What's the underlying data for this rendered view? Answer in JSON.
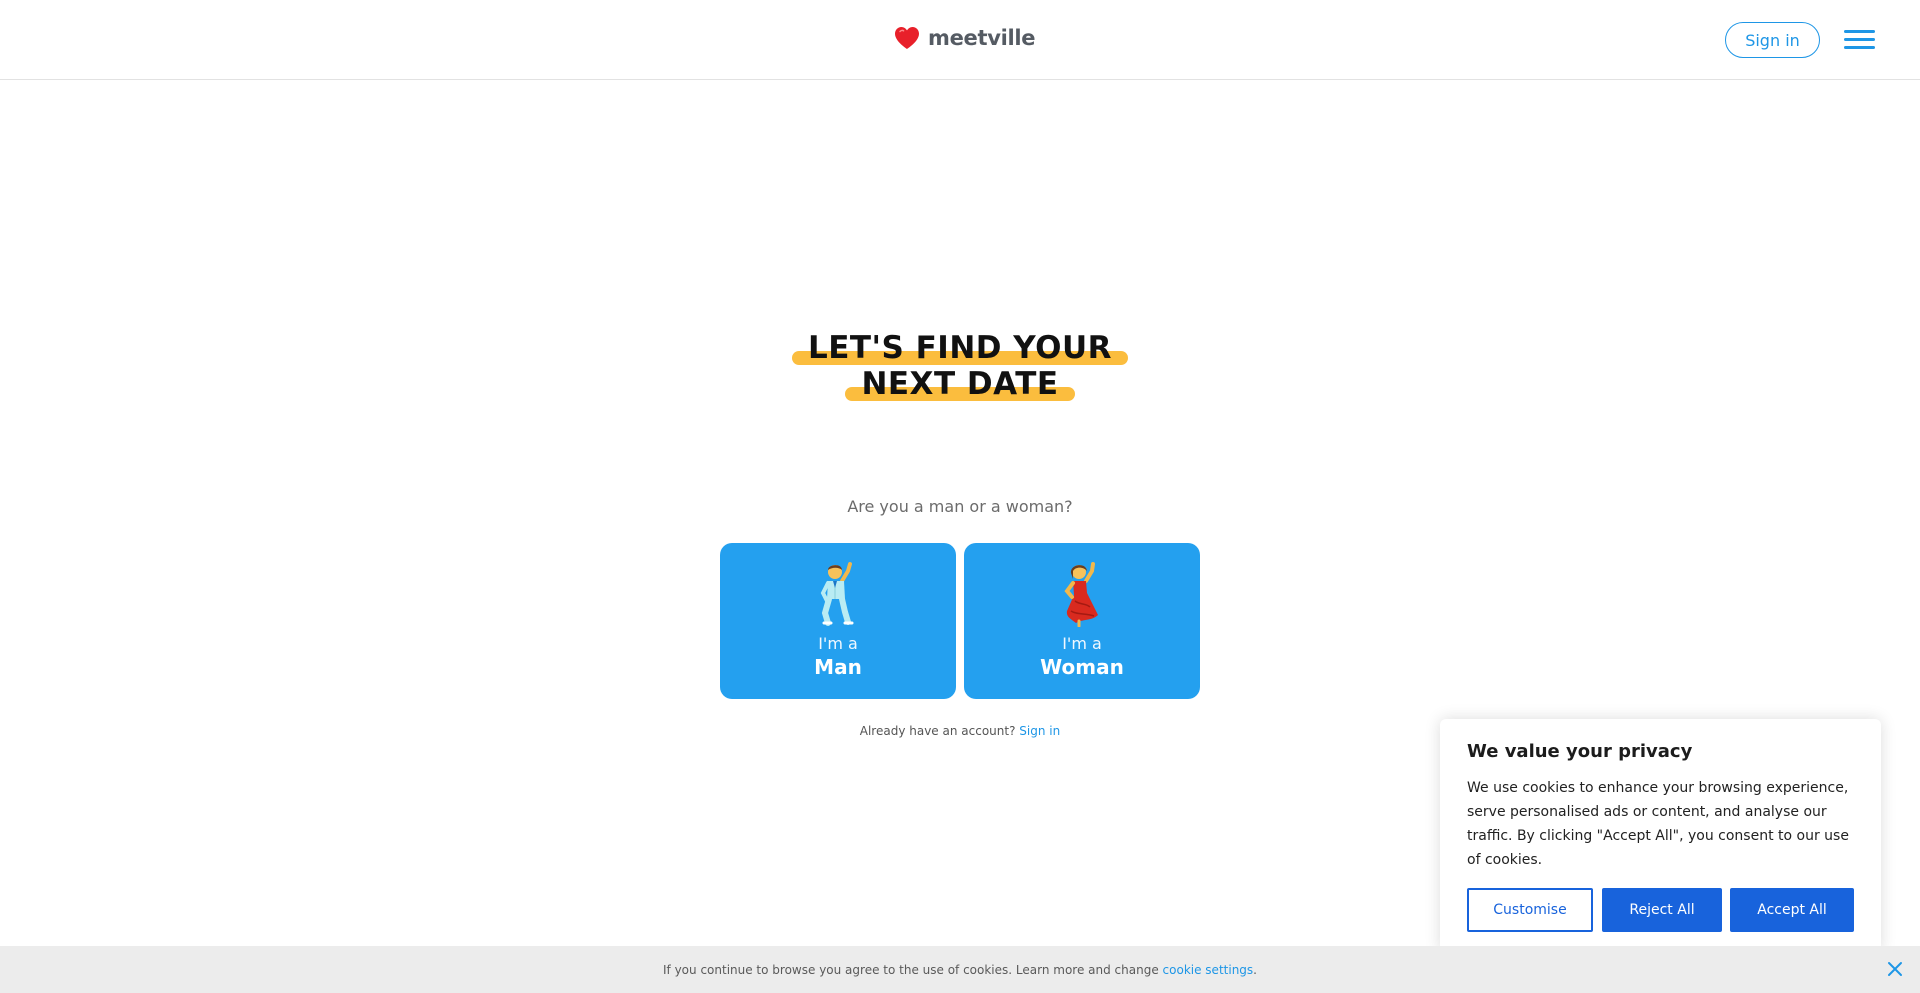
{
  "header": {
    "logo_text": "meetville",
    "signin_label": "Sign in",
    "brand_color": "#1e96e6",
    "heart_color": "#e8202a"
  },
  "hero": {
    "headline_line1": "LET'S FIND YOUR",
    "headline_line2": "NEXT DATE",
    "highlight_color": "#fbbd3e",
    "question": "Are you a man or a woman?",
    "choices": [
      {
        "prefix": "I'm a",
        "label": "Man",
        "icon": "man-dancing-icon"
      },
      {
        "prefix": "I'm a",
        "label": "Woman",
        "icon": "woman-dancing-icon"
      }
    ],
    "already_text": "Already have an account?",
    "already_link": "Sign in"
  },
  "consent": {
    "title": "We value your privacy",
    "body": "We use cookies to enhance your browsing experience, serve personalised ads or content, and analyse our traffic. By clicking \"Accept All\", you consent to our use of cookies.",
    "customise_label": "Customise",
    "reject_label": "Reject All",
    "accept_label": "Accept All",
    "button_color": "#1863dc"
  },
  "bottom_bar": {
    "text": "If you continue to browse you agree to the use of cookies. Learn more and change",
    "link": "cookie settings",
    "suffix": "."
  }
}
